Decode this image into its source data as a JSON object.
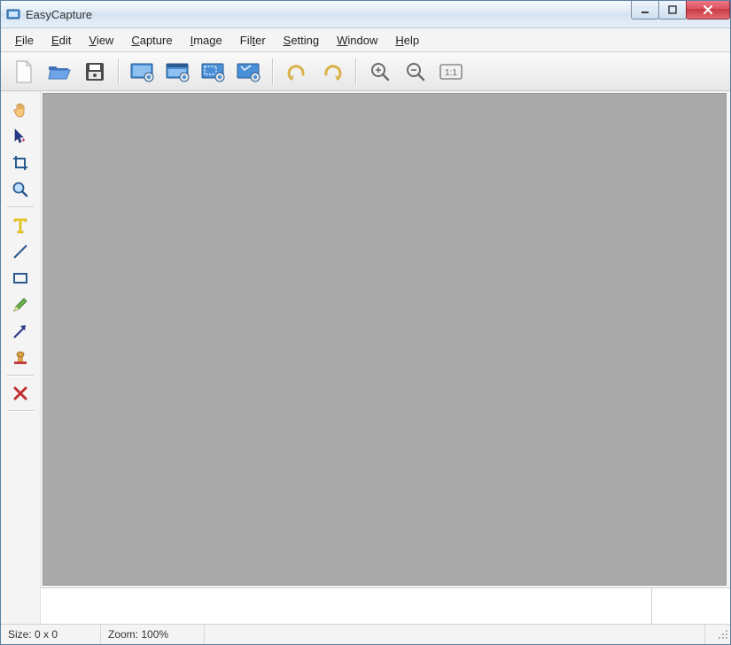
{
  "title": "EasyCapture",
  "menu": {
    "file": "File",
    "edit": "Edit",
    "view": "View",
    "capture": "Capture",
    "image": "Image",
    "filter": "Filter",
    "setting": "Setting",
    "window": "Window",
    "help": "Help"
  },
  "status": {
    "size_label": "Size: 0 x 0",
    "zoom_label": "Zoom: 100%"
  }
}
